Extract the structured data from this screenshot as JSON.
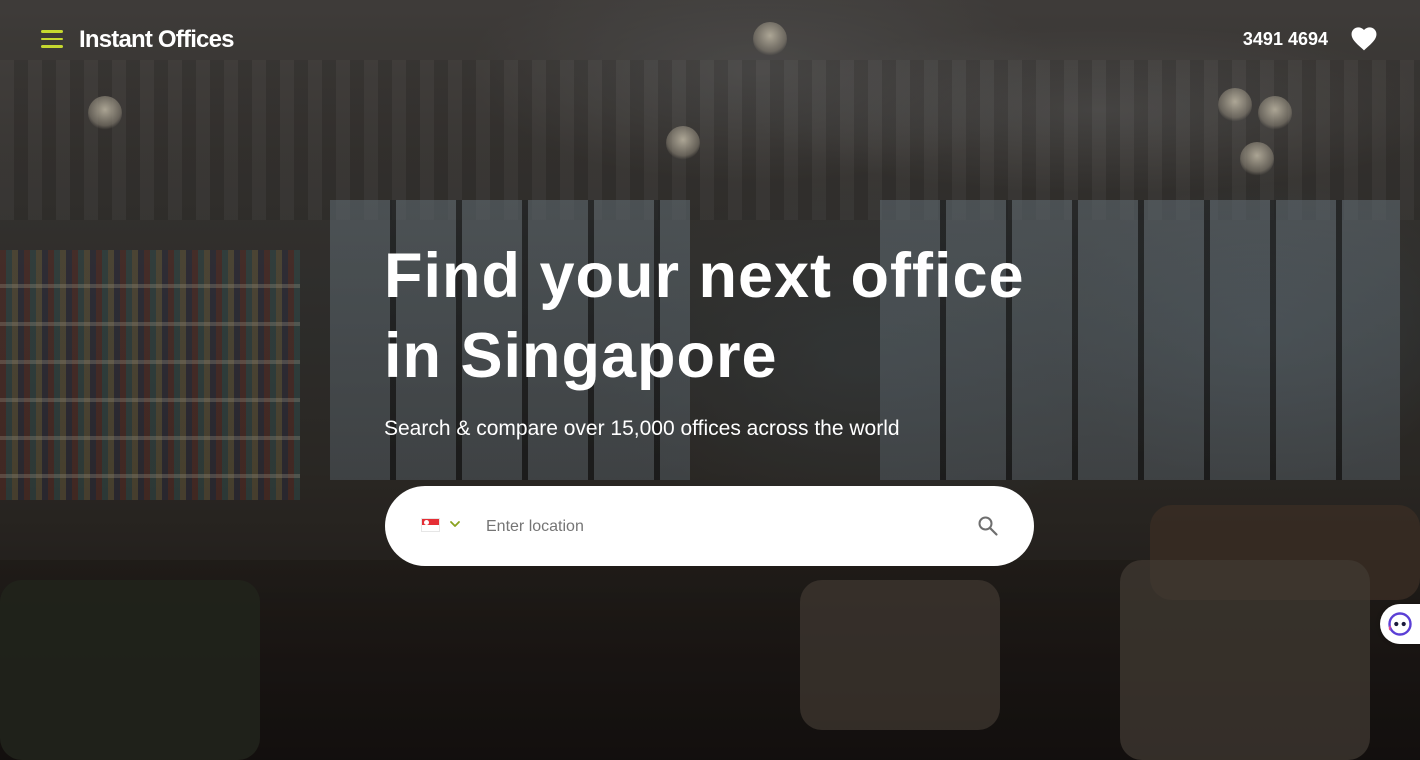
{
  "header": {
    "logo_text": "Instant Offices",
    "phone": "3491 4694",
    "menu_icon": "hamburger-menu-icon",
    "favorites_icon": "heart-icon",
    "accent_color": "#c5d82f"
  },
  "hero": {
    "headline_line1": "Find your next office",
    "headline_line2": "in Singapore",
    "subheadline": "Search & compare over 15,000 offices across the world"
  },
  "search": {
    "placeholder": "Enter location",
    "value": "",
    "country_flag": "singapore-flag-icon",
    "country_dropdown_icon": "chevron-down-icon",
    "search_icon": "search-icon"
  },
  "chat": {
    "icon": "chat-face-icon"
  }
}
